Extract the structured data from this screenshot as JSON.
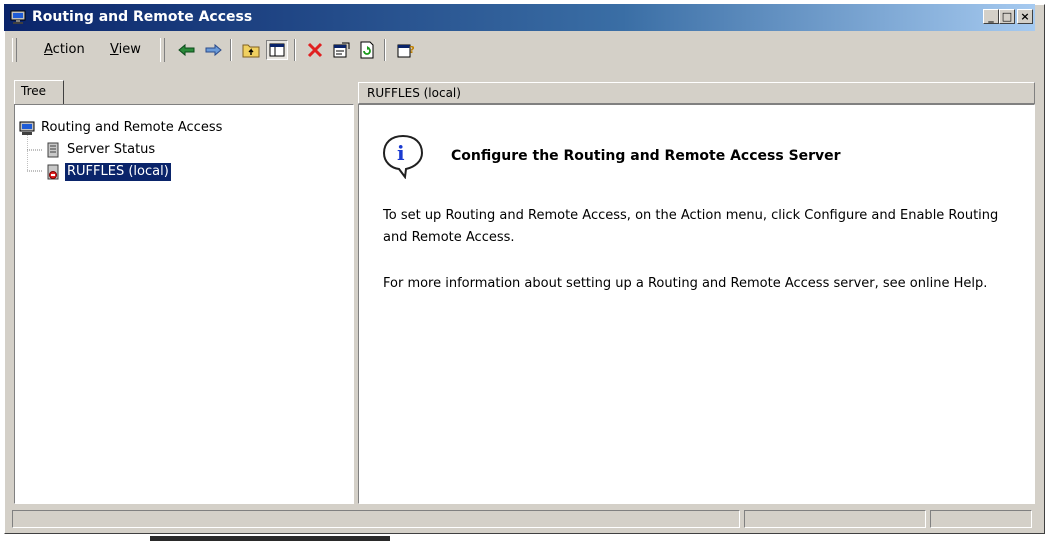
{
  "window": {
    "title": "Routing and Remote Access",
    "controls": {
      "minimize": "_",
      "maximize": "□",
      "close": "×"
    }
  },
  "toolbar": {
    "menus": [
      {
        "label_accel": "A",
        "label_rest": "ction"
      },
      {
        "label_accel": "V",
        "label_rest": "iew"
      }
    ],
    "icons": [
      "back-arrow-icon",
      "forward-arrow-icon",
      "up-folder-icon",
      "show-hide-tree-icon",
      "delete-icon",
      "properties-icon",
      "refresh-icon",
      "help-icon"
    ]
  },
  "tree": {
    "tab_label": "Tree",
    "items": [
      {
        "label": "Routing and Remote Access",
        "icon": "server-root-icon"
      },
      {
        "label": "Server Status",
        "icon": "server-status-icon"
      },
      {
        "label": "RUFFLES (local)",
        "icon": "server-stopped-icon",
        "selected": true
      }
    ]
  },
  "details": {
    "header": "RUFFLES (local)",
    "heading": "Configure the Routing and Remote Access Server",
    "paragraph1": "To set up Routing and Remote Access, on the Action menu, click Configure and Enable Routing and Remote Access.",
    "paragraph2": "For more information about setting up a Routing and Remote Access server, see online Help.",
    "icon": "info-icon"
  },
  "statusbar": {
    "panels": [
      "",
      "",
      ""
    ]
  },
  "colors": {
    "title_gradient_start": "#0a246a",
    "title_gradient_end": "#a6caf0",
    "face": "#d4d0c8",
    "selection": "#0a246a",
    "delete_red": "#e02020"
  }
}
